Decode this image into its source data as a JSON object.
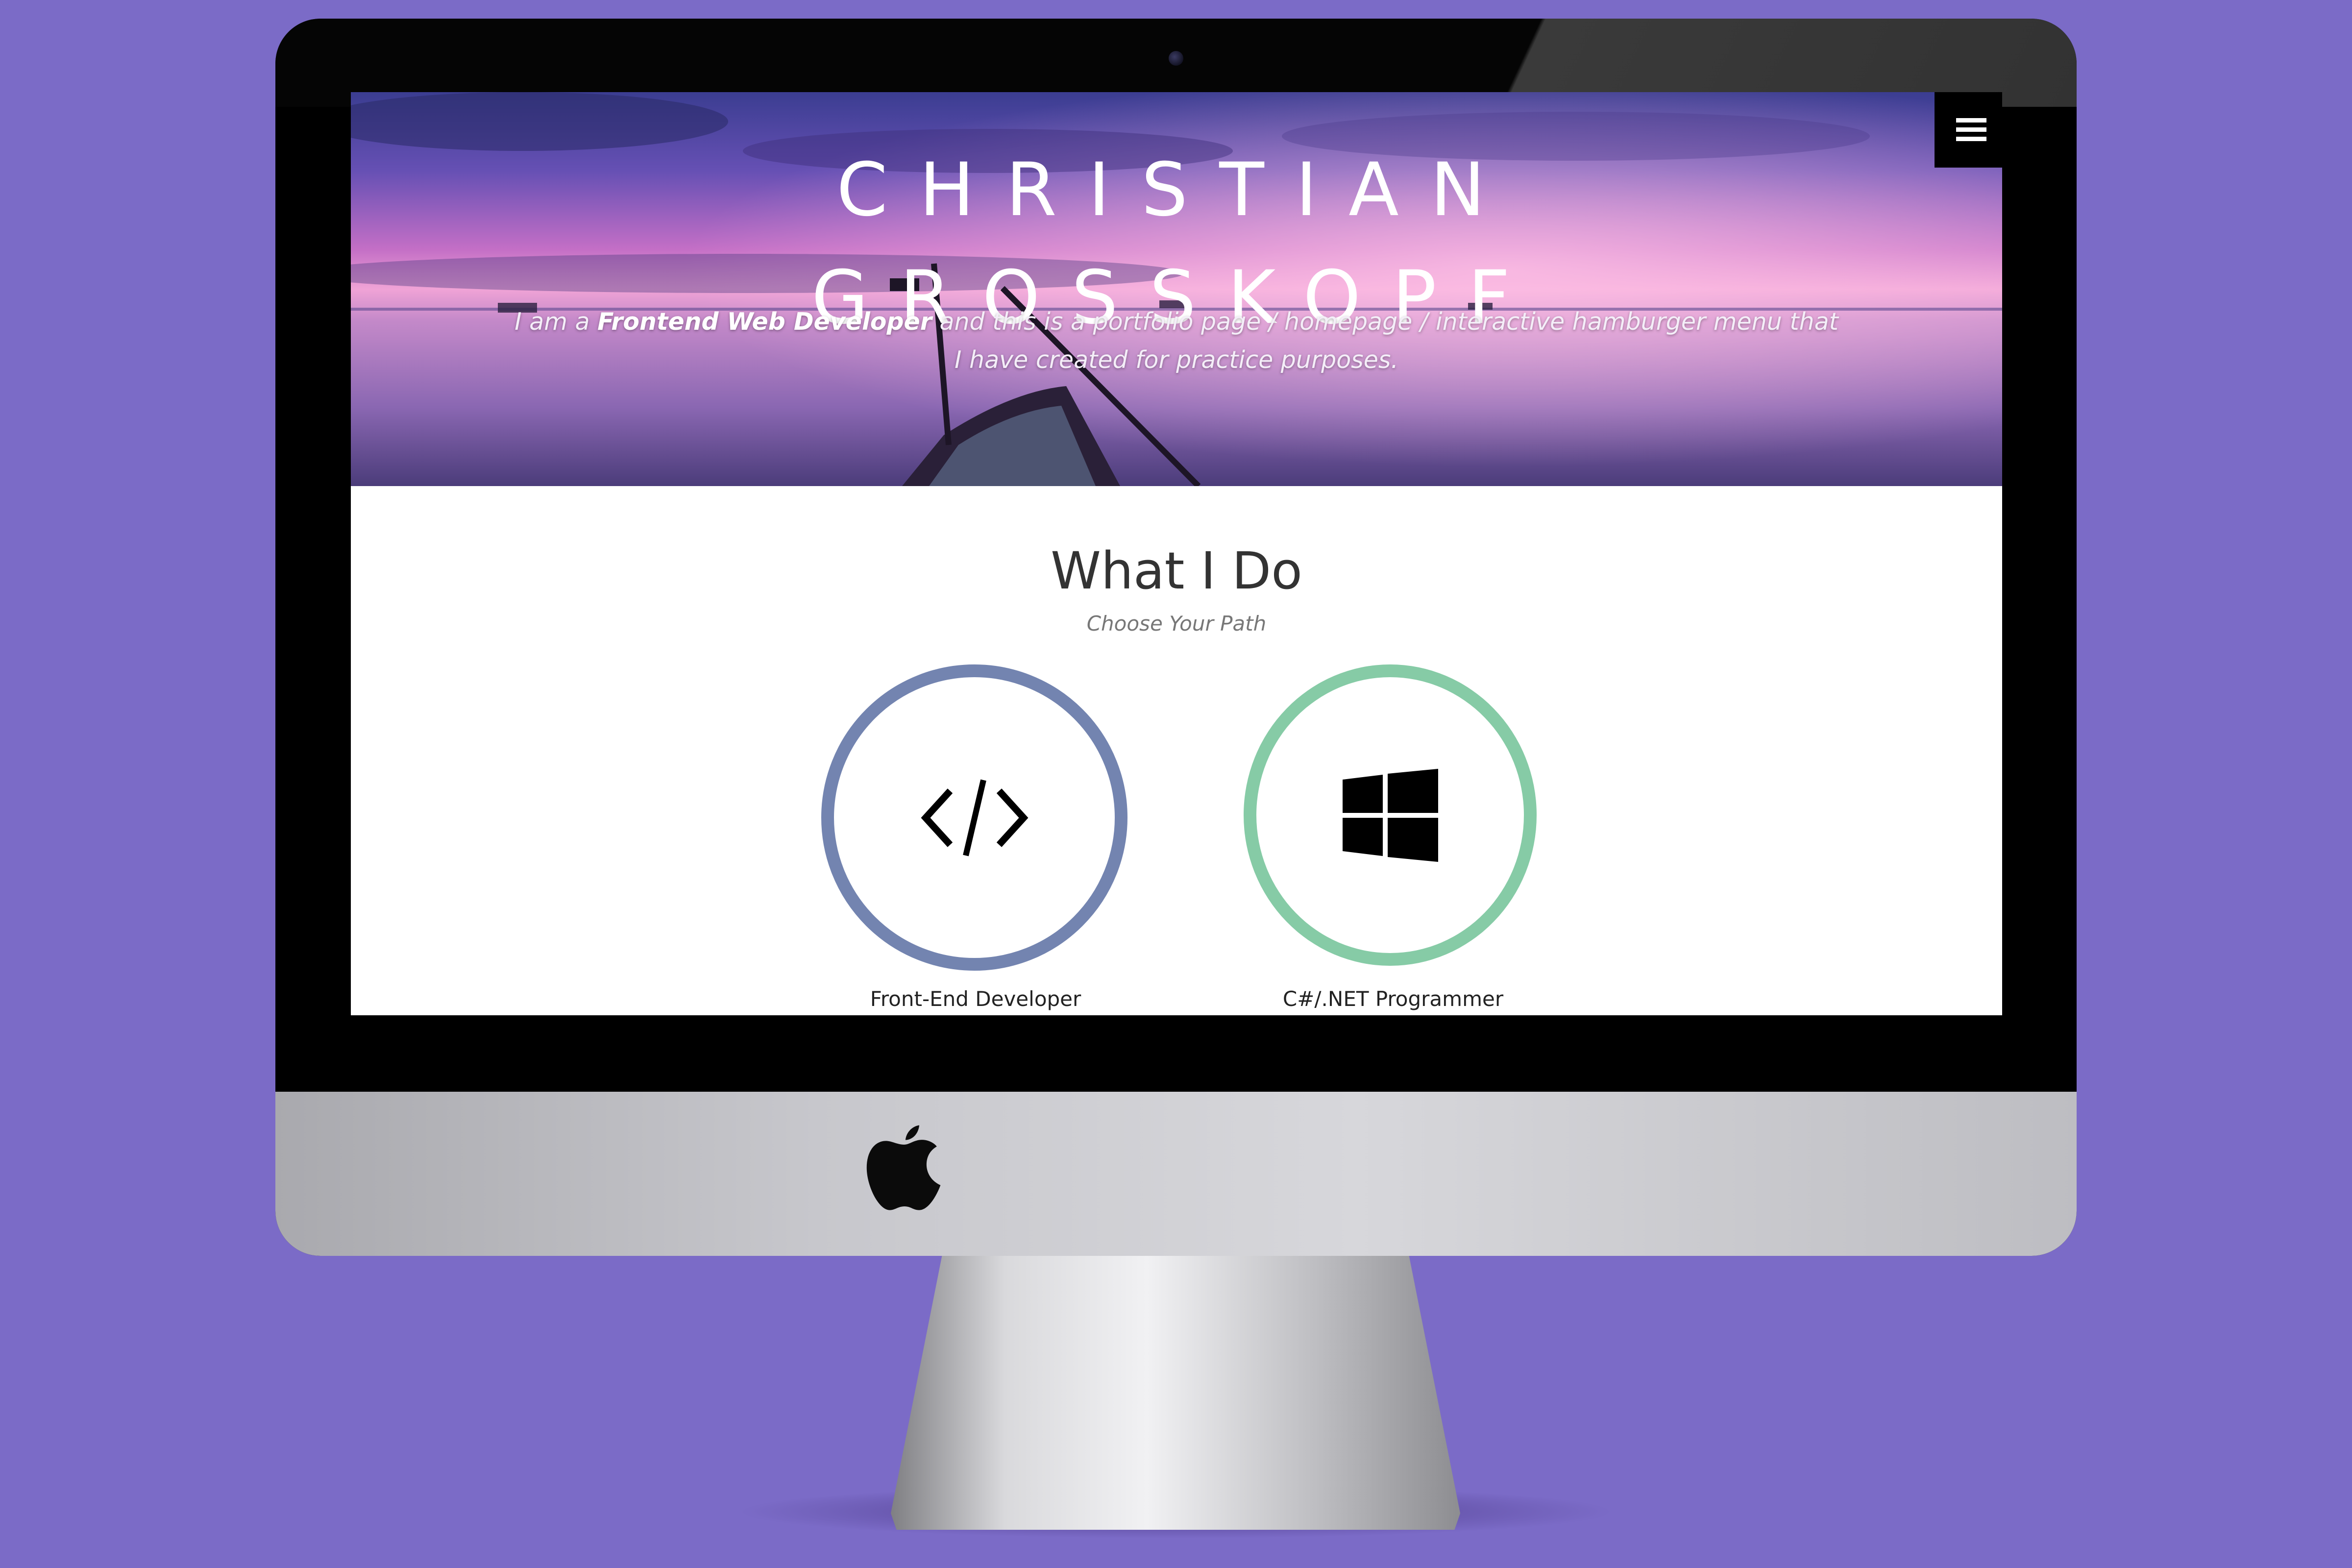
{
  "hero": {
    "title_line1": "CHRISTIAN",
    "title_line2": "GROSSKOPF",
    "desc_prefix": "I am a ",
    "desc_highlight": "Frontend Web Developer",
    "desc_suffix": " and this is a portfolio page / homepage / interactive hamburger menu that I have created for practice purposes."
  },
  "menu": {
    "icon": "hamburger-menu-icon"
  },
  "section": {
    "title": "What I Do",
    "subtitle": "Choose Your Path"
  },
  "paths": [
    {
      "label": "Front-End Developer",
      "icon": "code-icon",
      "ring_color": "#7384b0"
    },
    {
      "label": "C#/.NET Programmer",
      "icon": "windows-icon",
      "ring_color": "#86cba6"
    }
  ],
  "colors": {
    "background": "#7b6bc7",
    "accent_blue": "#7384b0",
    "accent_green": "#86cba6"
  }
}
